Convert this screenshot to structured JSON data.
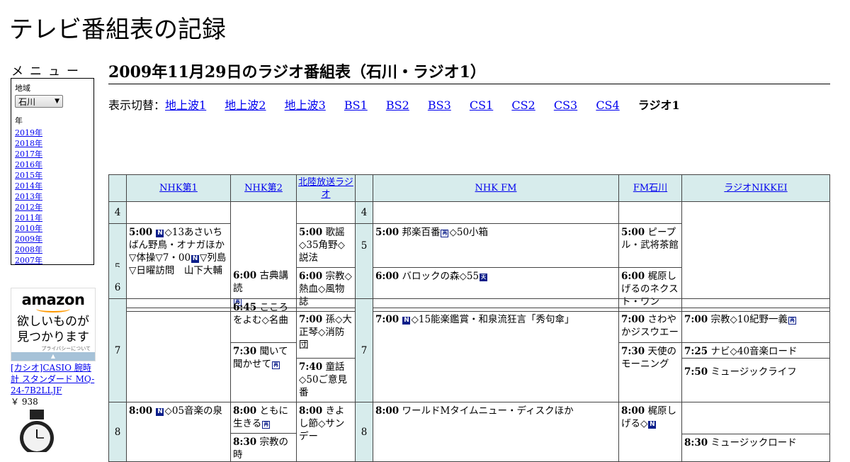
{
  "site_title": "テレビ番組表の記録",
  "menu": {
    "label": "メニュー",
    "region_label": "地域",
    "region_value": "石川",
    "year_label": "年",
    "years": [
      "2019年",
      "2018年",
      "2017年",
      "2016年",
      "2015年",
      "2014年",
      "2013年",
      "2012年",
      "2011年",
      "2010年",
      "2009年",
      "2008年",
      "2007年"
    ]
  },
  "ad": {
    "logo": "amazon",
    "copy_line1": "欲しいものが",
    "copy_line2": "見つかります",
    "privacy": "プライバシーについて",
    "product_title": "[カシオ]CASIO 腕時計 スタンダード MQ-24-7B2LLJF",
    "product_price": "￥ 938"
  },
  "page_heading": "2009年11月29日のラジオ番組表（石川・ラジオ1）",
  "switcher": {
    "prefix": "表示切替：",
    "links": [
      "地上波1",
      "地上波2",
      "地上波3",
      "BS1",
      "BS2",
      "BS3",
      "CS1",
      "CS2",
      "CS3",
      "CS4"
    ],
    "current": "ラジオ1"
  },
  "icons": {
    "news": "N",
    "rerun": "再",
    "weather": "天"
  },
  "channels": [
    "NHK第1",
    "NHK第2",
    "北陸放送ラジオ",
    "NHK FM",
    "FM石川",
    "ラジオNIKKEI"
  ],
  "hours": [
    "4",
    "5",
    "6",
    "7",
    "8"
  ],
  "programs": {
    "nhk1_500": {
      "time": "5:00",
      "pre": "",
      "post": "◇13あさいちばん野鳥・オナガほか▽体操▽7・00",
      "post2": "▽列島▽日曜訪問　山下大輔"
    },
    "nhk1_800": {
      "time": "8:00",
      "post": "◇05音楽の泉"
    },
    "nhk2_600": {
      "time": "6:00",
      "text": "古典講読"
    },
    "nhk2_645": {
      "time": "6:45",
      "text": "こころをよむ◇名曲"
    },
    "nhk2_730": {
      "time": "7:30",
      "text": "聞いて聞かせて"
    },
    "nhk2_800": {
      "time": "8:00",
      "text": "ともに生きる"
    },
    "nhk2_830": {
      "time": "8:30",
      "text": "宗教の時"
    },
    "mro_500": {
      "time": "5:00",
      "text": "歌謡◇35角野◇説法"
    },
    "mro_600": {
      "time": "6:00",
      "text": "宗教◇熱血◇風物誌"
    },
    "mro_700": {
      "time": "7:00",
      "text": "孫◇大正琴◇消防団"
    },
    "mro_740": {
      "time": "7:40",
      "text": "童話◇50ご意見番"
    },
    "mro_800": {
      "time": "8:00",
      "text": "きよし節◇サンデー"
    },
    "fm_500": {
      "time": "5:00",
      "text": "邦楽百番",
      "post": "◇50小箱"
    },
    "fm_600": {
      "time": "6:00",
      "text": "バロックの森◇55"
    },
    "fm_700": {
      "time": "7:00",
      "post": "◇15能楽鑑賞・和泉流狂言「秀句傘」"
    },
    "fm_800": {
      "time": "8:00",
      "text": "ワールドMタイムニュー・ディスクほか"
    },
    "fmi_500": {
      "time": "5:00",
      "text": "ピープル・武将茶館"
    },
    "fmi_600": {
      "time": "6:00",
      "text": "梶原しげるのネクスト・ワン"
    },
    "fmi_700": {
      "time": "7:00",
      "text": "さわやかジスウエー"
    },
    "fmi_730": {
      "time": "7:30",
      "text": "天使のモーニング"
    },
    "fmi_800": {
      "time": "8:00",
      "text": "梶原しげる◇"
    },
    "nik_700": {
      "time": "7:00",
      "text": "宗教◇10紀野一義"
    },
    "nik_725": {
      "time": "7:25",
      "text": "ナビ◇40音楽ロード"
    },
    "nik_750": {
      "time": "7:50",
      "text": "ミュージックライフ"
    },
    "nik_830": {
      "time": "8:30",
      "text": "ミュージックロード"
    }
  }
}
